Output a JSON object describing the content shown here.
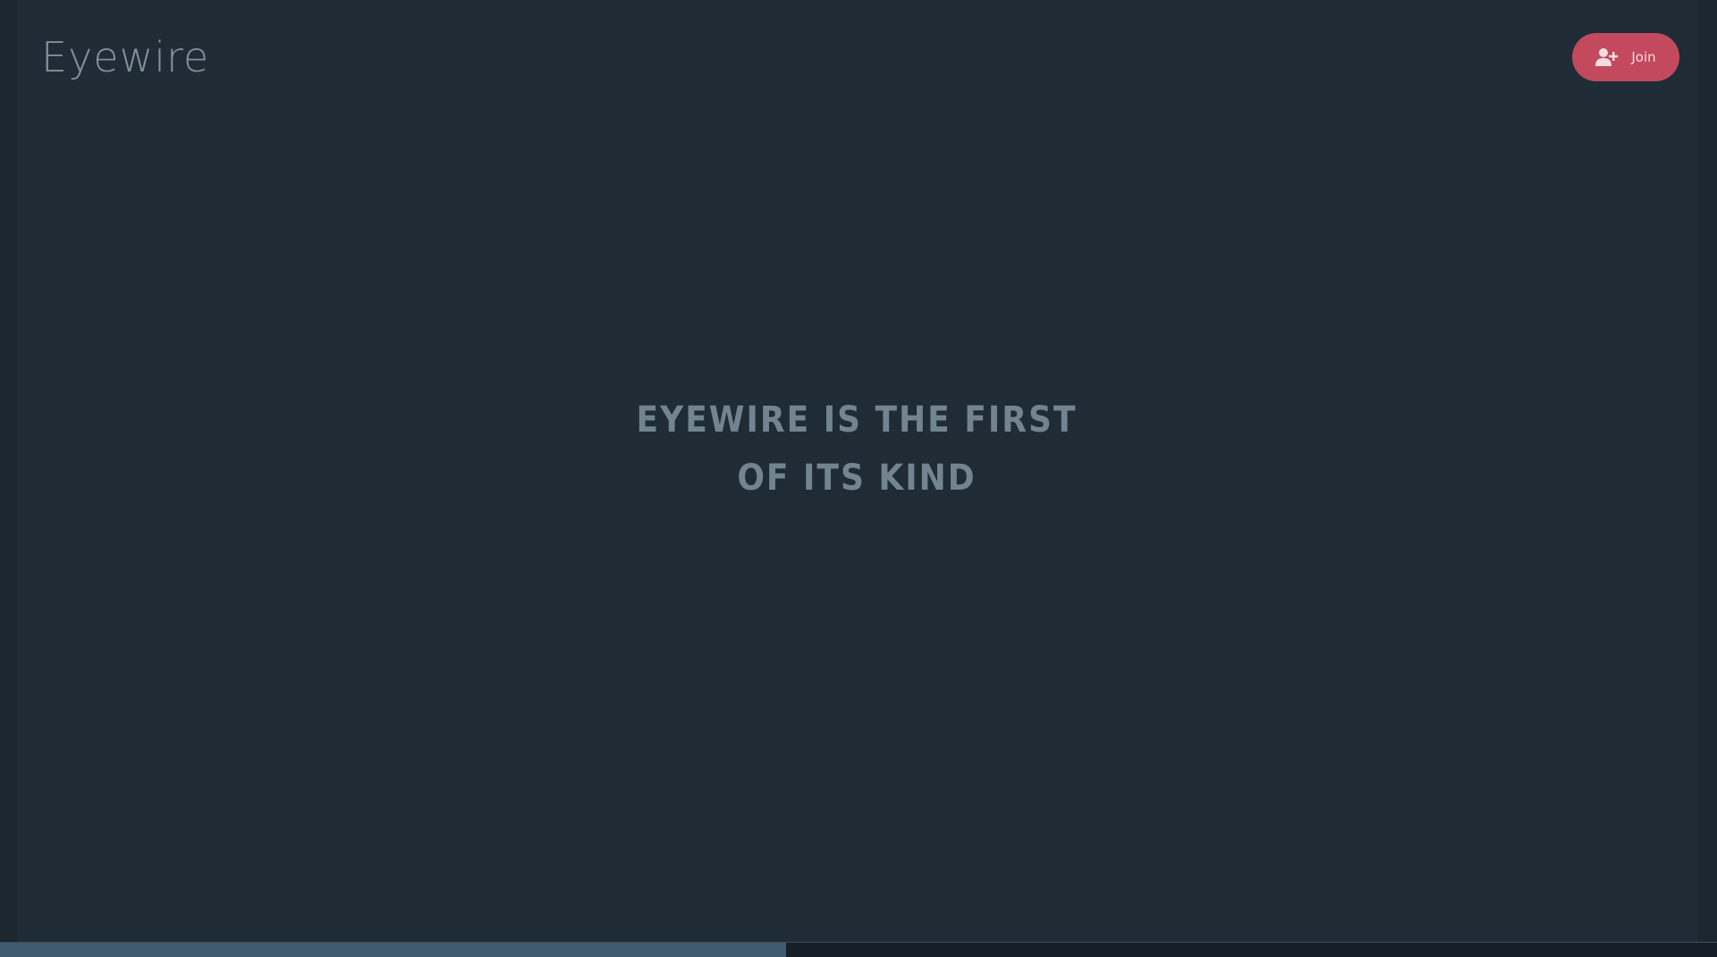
{
  "header": {
    "logo_text": "Eyewire",
    "join_label": "Join",
    "join_icon": "user-plus-icon",
    "join_color": "#c3495e"
  },
  "hero": {
    "line1": "EYEWIRE IS THE FIRST",
    "line2": "OF ITS KIND"
  },
  "progress": {
    "fraction": 0.458
  },
  "colors": {
    "background": "#1f2b35",
    "headline": "#72848f",
    "logo": "#7f919d",
    "progress_fill": "#425a6e"
  }
}
